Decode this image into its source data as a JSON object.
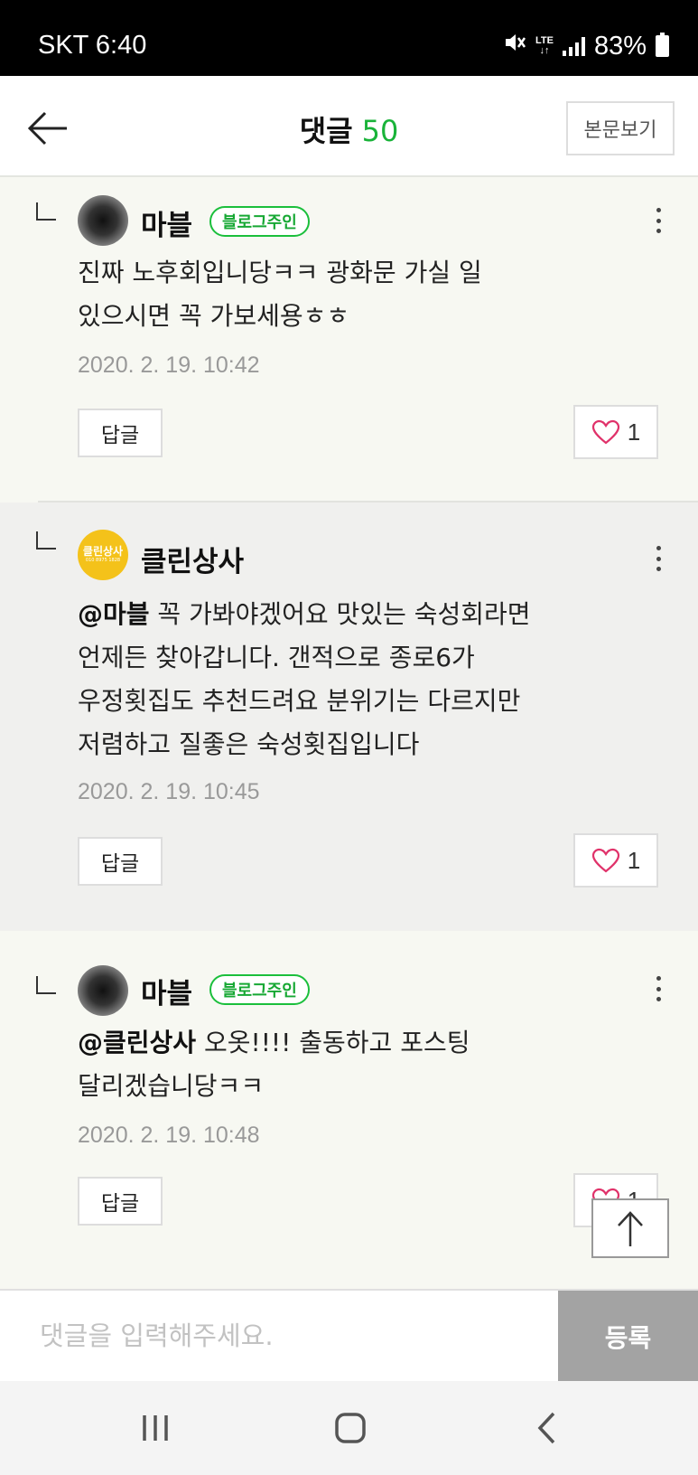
{
  "status_bar": {
    "carrier_time": "SKT 6:40",
    "network": "LTE",
    "battery": "83%",
    "icons": [
      "mute-icon",
      "lte-icon",
      "signal-icon",
      "battery-icon"
    ]
  },
  "header": {
    "title": "댓글",
    "count": "50",
    "view_post_label": "본문보기",
    "count_color": "#19b339"
  },
  "comments": [
    {
      "nickname": "마블",
      "badge": "블로그주인",
      "mention": "",
      "text_lines": [
        "진짜 노후회입니당ㅋㅋ 광화문 가실 일",
        "있으시면 꼭 가보세용ㅎㅎ"
      ],
      "date": "2020. 2. 19. 10:42",
      "reply_label": "답글",
      "likes": "1"
    },
    {
      "nickname": "클린상사",
      "avatar_text": "클린상사",
      "avatar_subtext": "010 8975 1828",
      "mention": "@마블",
      "text_lines": [
        " 꼭 가봐야겠어요 맛있는 숙성회라면",
        "언제든 찾아갑니다. 갠적으로 종로6가",
        "우정횟집도 추천드려요 분위기는 다르지만",
        "저렴하고 질좋은 숙성횟집입니다"
      ],
      "date": "2020. 2. 19. 10:45",
      "reply_label": "답글",
      "likes": "1"
    },
    {
      "nickname": "마블",
      "badge": "블로그주인",
      "mention": "@클린상사",
      "text_lines": [
        " 오옷!!!! 출동하고 포스팅",
        "달리겠습니당ㅋㅋ"
      ],
      "date": "2020. 2. 19. 10:48",
      "reply_label": "답글",
      "likes": "1"
    }
  ],
  "input": {
    "placeholder": "댓글을 입력해주세요.",
    "submit_label": "등록"
  },
  "colors": {
    "badge_green": "#17a834",
    "like_heart": "#e0326a",
    "submit_bg": "#a3a3a3"
  }
}
